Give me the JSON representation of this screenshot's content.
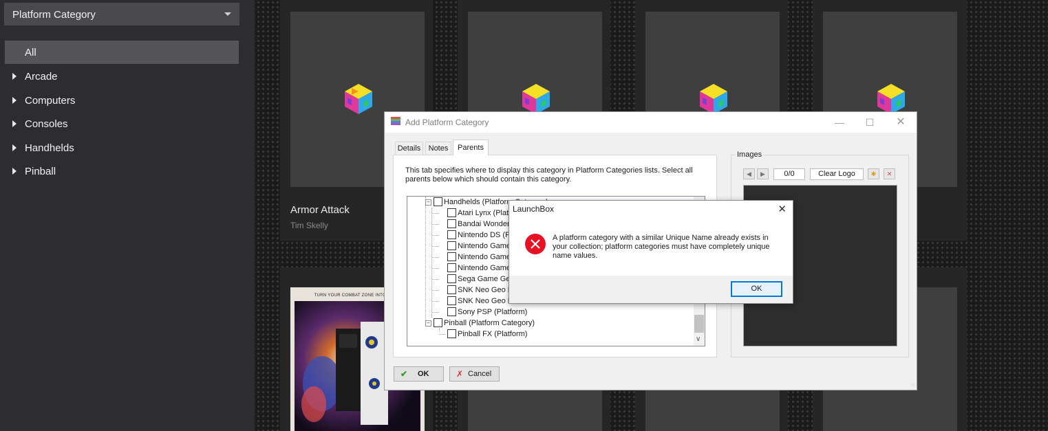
{
  "sidebar": {
    "dropdown_value": "Platform Category",
    "items": [
      {
        "label": "All"
      },
      {
        "label": "Arcade"
      },
      {
        "label": "Computers"
      },
      {
        "label": "Consoles"
      },
      {
        "label": "Handhelds"
      },
      {
        "label": "Pinball"
      }
    ]
  },
  "games": {
    "first": {
      "title": "Armor Attack",
      "developer": "Tim Skelly"
    },
    "poster_caption": "TURN YOUR COMBAT ZONE INTO A PRO"
  },
  "dialog": {
    "title": "Add Platform Category",
    "tabs": [
      {
        "label": "Details"
      },
      {
        "label": "Notes"
      },
      {
        "label": "Parents"
      }
    ],
    "description": "This tab specifies where to display this category in Platform Categories lists. Select all parents below which should contain this category.",
    "tree": {
      "handhelds": "Handhelds (Platform Category)",
      "items": [
        "Atari Lynx (Platform)",
        "Bandai WonderSwan",
        "Nintendo DS (Platform)",
        "Nintendo Game",
        "Nintendo Game",
        "Nintendo Game",
        "Sega Game Gear",
        "SNK Neo Geo Pocket",
        "SNK Neo Geo Pocket",
        "Sony PSP (Platform)"
      ],
      "pinball": "Pinball (Platform Category)",
      "pinball_items": [
        "Pinball FX (Platform)"
      ]
    },
    "images": {
      "label": "Images",
      "counter": "0/0",
      "clear_logo": "Clear Logo"
    },
    "ok_label": "OK",
    "cancel_label": "Cancel"
  },
  "message_box": {
    "title": "LaunchBox",
    "text": "A platform category with a similar Unique Name already exists in your collection; platform categories must have completely unique name values.",
    "ok_label": "OK"
  },
  "colors": {
    "sidebar_bg": "#2d2d30",
    "accent": "#0078d7",
    "error_red": "#e81123"
  }
}
